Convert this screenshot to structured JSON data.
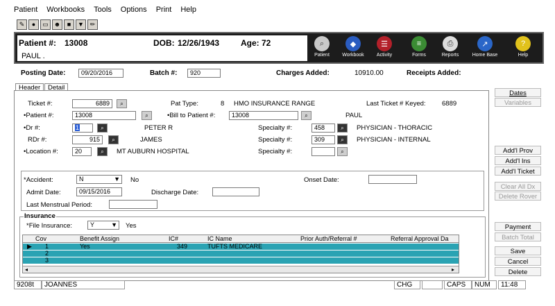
{
  "menu": [
    "Patient",
    "Workbooks",
    "Tools",
    "Options",
    "Print",
    "Help"
  ],
  "toolbar_icons": [
    "edit-icon",
    "record-icon",
    "window-icon",
    "person-icon",
    "save-icon",
    "filter-icon",
    "pencil-icon"
  ],
  "patient": {
    "number_label": "Patient #:",
    "number": "13008",
    "dob_label": "DOB:",
    "dob": "12/26/1943",
    "age_label": "Age:",
    "age": "72",
    "name": "PAUL ."
  },
  "header_buttons": [
    {
      "label": "Patient",
      "icon": "magnifier-icon",
      "color": "#c9c9c9"
    },
    {
      "label": "Workbook",
      "icon": "book-icon",
      "color": "#2a5cc0"
    },
    {
      "label": "Activity",
      "icon": "list-icon",
      "color": "#b3202a"
    },
    {
      "label": "Forms",
      "icon": "forms-icon",
      "color": "#3b8c34"
    },
    {
      "label": "Reports",
      "icon": "printer-icon",
      "color": "#dddddd"
    },
    {
      "label": "Home Base",
      "icon": "home-icon",
      "color": "#2a66c8"
    },
    {
      "label": "Help",
      "icon": "help-icon",
      "color": "#e1c21c"
    }
  ],
  "posting": {
    "date_label": "Posting Date:",
    "date": "09/20/2016",
    "batch_label": "Batch #:",
    "batch": "920",
    "charges_label": "Charges Added:",
    "charges": "10910.00",
    "receipts_label": "Receipts Added:"
  },
  "tabs": [
    "Header",
    "Detail"
  ],
  "form": {
    "ticket_label": "Ticket #:",
    "ticket": "6889",
    "pattype_label": "Pat Type:",
    "pattype_code": "8",
    "pattype_desc": "HMO INSURANCE RANGE",
    "lastticket_label": "Last Ticket # Keyed:",
    "lastticket": "6889",
    "patient_label": "•Patient #:",
    "patient": "13008",
    "billto_label": "•Bill to Patient #:",
    "billto": "13008",
    "billto_name": "PAUL",
    "dr_label": "•Dr #:",
    "dr": "1",
    "dr_name": "PETER R",
    "specialty1_label": "Specialty #:",
    "specialty1": "458",
    "specialty1_desc": "PHYSICIAN - THORACIC",
    "rdr_label": "RDr #:",
    "rdr": "915",
    "rdr_name": "JAMES",
    "specialty2_label": "Specialty #:",
    "specialty2": "309",
    "specialty2_desc": "PHYSICIAN - INTERNAL",
    "location_label": "•Location #:",
    "location": "20",
    "location_name": "MT AUBURN HOSPITAL",
    "specialty3_label": "Specialty #:",
    "specialty3": ""
  },
  "accident": {
    "label": "*Accident:",
    "value": "N",
    "desc": "No",
    "onset_label": "Onset Date:",
    "onset": "",
    "admit_label": "Admit Date:",
    "admit": "09/15/2016",
    "discharge_label": "Discharge Date:",
    "discharge": "",
    "lmp_label": "Last Menstrual Period:",
    "lmp": ""
  },
  "insurance": {
    "title": "Insurance",
    "file_label": "*File Insurance:",
    "file_value": "Y",
    "file_desc": "Yes",
    "columns": [
      "Cov",
      "Benefit Assign",
      "IC#",
      "IC Name",
      "Prior Auth/Referral #",
      "Referral Approval Da"
    ],
    "rows": [
      {
        "cov": "1",
        "benefit": "Yes",
        "ic": "349",
        "name": "TUFTS MEDICARE",
        "auth": "",
        "approval": ""
      },
      {
        "cov": "2",
        "benefit": "",
        "ic": "",
        "name": "",
        "auth": "",
        "approval": ""
      },
      {
        "cov": "3",
        "benefit": "",
        "ic": "",
        "name": "",
        "auth": "",
        "approval": ""
      }
    ]
  },
  "side_buttons": {
    "dates": "Dates",
    "variables": "Variables",
    "addl_prov": "Add'l Prov",
    "addl_ins": "Add'l Ins",
    "addl_ticket": "Add'l Ticket",
    "clear_all": "Clear All Dx",
    "delete_rover": "Delete Rover",
    "payment": "Payment",
    "batch_total": "Batch Total",
    "save": "Save",
    "cancel": "Cancel",
    "delete": "Delete"
  },
  "status": {
    "code": "9208t",
    "user": "JOANNES",
    "chg": "CHG",
    "caps": "CAPS",
    "num": "NUM",
    "time": "11:48"
  },
  "colors": {
    "grid_row": "#2aa3b3",
    "header_bg": "#1c1c1c"
  }
}
